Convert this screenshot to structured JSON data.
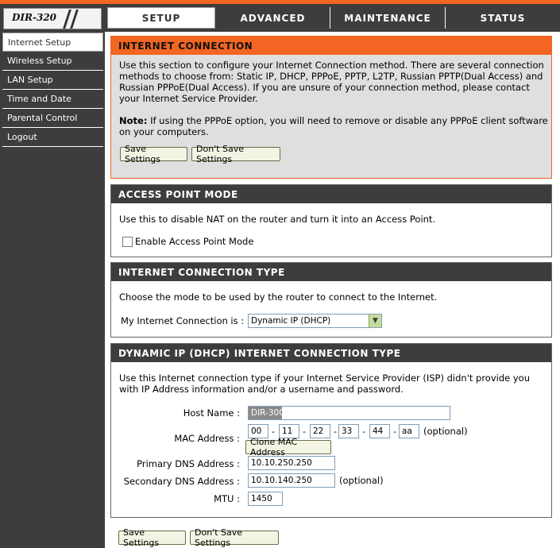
{
  "logo": {
    "model": "DIR-320"
  },
  "tabs": [
    {
      "label": "SETUP"
    },
    {
      "label": "ADVANCED"
    },
    {
      "label": "MAINTENANCE"
    },
    {
      "label": "STATUS"
    }
  ],
  "sidebar": {
    "items": [
      {
        "label": "Internet Setup"
      },
      {
        "label": "Wireless Setup"
      },
      {
        "label": "LAN Setup"
      },
      {
        "label": "Time and Date"
      },
      {
        "label": "Parental Control"
      },
      {
        "label": "Logout"
      }
    ]
  },
  "internet_connection": {
    "title": "INTERNET CONNECTION",
    "description": "Use this section to configure your Internet Connection method. There are several connection methods to choose from: Static IP, DHCP, PPPoE, PPTP, L2TP, Russian PPTP(Dual Access) and Russian PPPoE(Dual Access). If you are unsure of your connection method, please contact your Internet Service Provider.",
    "note_label": "Note:",
    "note_text": " If using the PPPoE option, you will need to remove or disable any PPPoE client software on your computers.",
    "save_label": "Save Settings",
    "dont_save_label": "Don't Save Settings"
  },
  "access_point": {
    "title": "ACCESS POINT MODE",
    "description": "Use this to disable NAT on the router and turn it into an Access Point.",
    "checkbox_label": "Enable Access Point Mode"
  },
  "connection_type": {
    "title": "INTERNET CONNECTION TYPE",
    "description": "Choose the mode to be used by the router to connect to the Internet.",
    "select_label": "My Internet Connection is :",
    "selected": "Dynamic IP (DHCP)"
  },
  "dhcp": {
    "title": "DYNAMIC IP (DHCP) INTERNET CONNECTION TYPE",
    "description": "Use this Internet connection type if your Internet Service Provider (ISP) didn't provide you with IP Address information and/or a username and password.",
    "host_label": "Host Name :",
    "host_value": "DIR-300",
    "mac_label": "MAC Address :",
    "mac": [
      "00",
      "11",
      "22",
      "33",
      "44",
      "aa"
    ],
    "mac_dash": "-",
    "optional": "(optional)",
    "clone_label": "Clone MAC Address",
    "dns1_label": "Primary DNS Address :",
    "dns1_value": "10.10.250.250",
    "dns2_label": "Secondary DNS Address :",
    "dns2_value": "10.10.140.250",
    "mtu_label": "MTU :",
    "mtu_value": "1450"
  },
  "bottom": {
    "save_label": "Save Settings",
    "dont_save_label": "Don't Save Settings"
  }
}
